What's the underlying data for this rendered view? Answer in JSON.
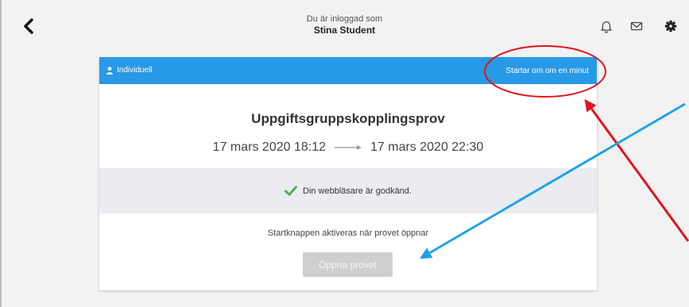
{
  "header": {
    "logged_in_as": "Du är inloggad som",
    "user_name": "Stina Student",
    "icons": [
      "back-chevron-icon",
      "bell-icon",
      "mail-icon",
      "gear-icon"
    ]
  },
  "exam_card": {
    "type_label": "Individuell",
    "status": "Startar om om en minut",
    "title": "Uppgiftsgruppskopplingsprov",
    "start": "17 mars 2020 18:12",
    "end": "17 mars 2020 22:30",
    "browser_status": "Din webbläsare är godkänd.",
    "note": "Startknappen aktiveras när provet öppnar",
    "open_button": "Öppna provet"
  },
  "colors": {
    "accent": "#2899e6",
    "check": "#4caf50",
    "annotation_red": "#e0141c",
    "annotation_blue": "#1fa3e6",
    "button_disabled": "#cfcfcf"
  }
}
